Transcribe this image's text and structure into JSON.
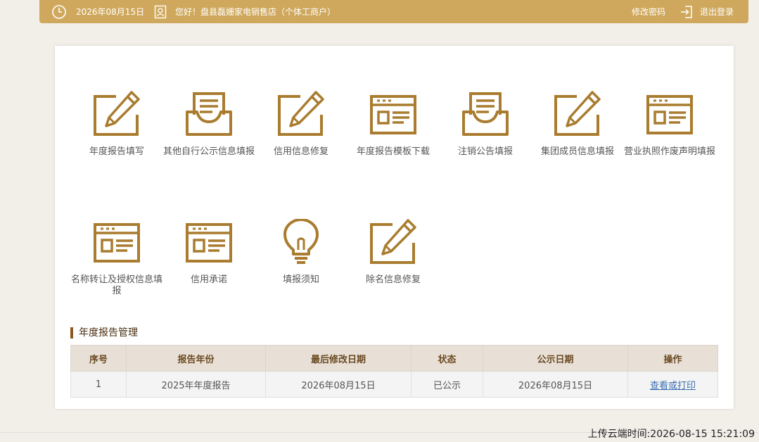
{
  "header": {
    "date": "2026年08月15日",
    "greeting": "您好！盘县磊姗家电销售店（个体工商户）",
    "change_password": "修改密码",
    "logout": "退出登录",
    "icons": [
      "clock-icon",
      "user-icon",
      "logout-icon"
    ]
  },
  "tiles": [
    {
      "label": "年度报告填写",
      "icon": "edit-icon"
    },
    {
      "label": "其他自行公示信息填报",
      "icon": "inbox-icon"
    },
    {
      "label": "信用信息修复",
      "icon": "edit-icon"
    },
    {
      "label": "年度报告模板下载",
      "icon": "template-icon"
    },
    {
      "label": "注销公告填报",
      "icon": "inbox-icon"
    },
    {
      "label": "集团成员信息填报",
      "icon": "edit-icon"
    },
    {
      "label": "营业执照作废声明填报",
      "icon": "template-icon"
    },
    {
      "label": "名称转让及授权信息填报",
      "icon": "template-icon"
    },
    {
      "label": "信用承诺",
      "icon": "template-icon"
    },
    {
      "label": "填报须知",
      "icon": "lightbulb-icon"
    },
    {
      "label": "除名信息修复",
      "icon": "edit-icon"
    }
  ],
  "section": {
    "title": "年度报告管理"
  },
  "table": {
    "headers": [
      "序号",
      "报告年份",
      "最后修改日期",
      "状态",
      "公示日期",
      "操作"
    ],
    "rows": [
      [
        "1",
        "2025年年度报告",
        "2026年08月15日",
        "已公示",
        "2026年08月15日",
        "查看或打印"
      ]
    ]
  },
  "footer": {
    "upload_time": "上传云端时间:2026-08-15 15:21:09"
  },
  "colors": {
    "accent": "#cfa85d",
    "icon": "#a97c2f",
    "section_bar": "#8c5a1e"
  }
}
